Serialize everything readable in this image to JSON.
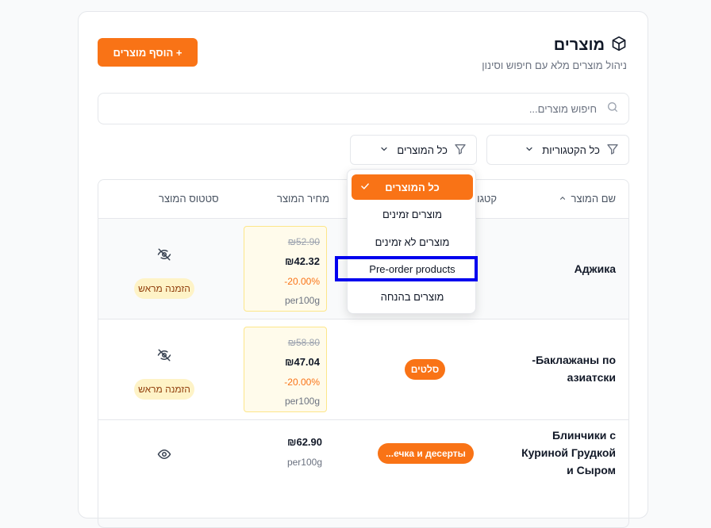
{
  "header": {
    "title": "מוצרים",
    "subtitle": "ניהול מוצרים מלא עם חיפוש וסינון",
    "add_button": "+ הוסף מוצרים"
  },
  "search": {
    "placeholder": "חיפוש מוצרים..."
  },
  "filters": {
    "category": "כל הקטגוריות",
    "status": "כל המוצרים"
  },
  "table": {
    "columns": {
      "name": "שם המוצר",
      "category": "קטגו",
      "price": "מחיר המוצר",
      "status": "סטטוס המוצר"
    },
    "rows": [
      {
        "name": "Аджика",
        "category": "",
        "old_price": "₪52.90",
        "price": "₪42.32",
        "discount": "-20.00%",
        "unit": "per100g",
        "status": "הזמנה מראש",
        "visibility": "eye-off"
      },
      {
        "name_line1": "Баклажаны по-",
        "name_line2": "азиатски",
        "category": "סלטים",
        "old_price": "₪58.80",
        "price": "₪47.04",
        "discount": "-20.00%",
        "unit": "per100g",
        "status": "הזמנה מראש",
        "visibility": "eye-off"
      },
      {
        "name_line1": "Блинчики с",
        "name_line2": "Куриной Грудкой",
        "name_line3": "и Сыром",
        "category": "...ечка и десерты",
        "price": "₪62.90",
        "unit": "per100g",
        "visibility": "eye"
      }
    ]
  },
  "dropdown": {
    "options": [
      "כל המוצרים",
      "מוצרים זמינים",
      "מוצרים לא זמינים",
      "Pre-order products",
      "מוצרים בהנחה"
    ],
    "selected": "כל המוצרים",
    "highlighted": "Pre-order products"
  },
  "colors": {
    "accent": "#f97316",
    "highlight_border": "#0000ee",
    "preorder_badge_bg": "#fef3c7",
    "price_box_bg": "#fffbeb"
  },
  "icons": {
    "title": "box-icon",
    "search": "search-icon",
    "filter": "filter-icon",
    "chevron": "chevron-down-icon",
    "sort": "chevron-up-icon",
    "check": "check-icon"
  }
}
